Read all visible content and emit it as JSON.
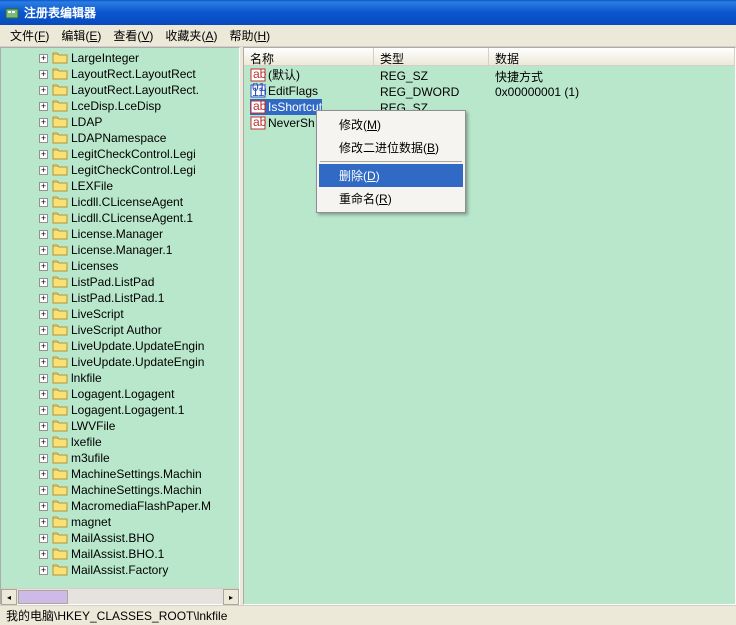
{
  "window": {
    "title": "注册表编辑器"
  },
  "menubar": {
    "file": "文件",
    "file_accel": "F",
    "edit": "编辑",
    "edit_accel": "E",
    "view": "查看",
    "view_accel": "V",
    "fav": "收藏夹",
    "fav_accel": "A",
    "help": "帮助",
    "help_accel": "H"
  },
  "tree": {
    "items": [
      {
        "label": "LargeInteger"
      },
      {
        "label": "LayoutRect.LayoutRect"
      },
      {
        "label": "LayoutRect.LayoutRect."
      },
      {
        "label": "LceDisp.LceDisp"
      },
      {
        "label": "LDAP"
      },
      {
        "label": "LDAPNamespace"
      },
      {
        "label": "LegitCheckControl.Legi"
      },
      {
        "label": "LegitCheckControl.Legi"
      },
      {
        "label": "LEXFile"
      },
      {
        "label": "Licdll.CLicenseAgent"
      },
      {
        "label": "Licdll.CLicenseAgent.1"
      },
      {
        "label": "License.Manager"
      },
      {
        "label": "License.Manager.1"
      },
      {
        "label": "Licenses"
      },
      {
        "label": "ListPad.ListPad"
      },
      {
        "label": "ListPad.ListPad.1"
      },
      {
        "label": "LiveScript"
      },
      {
        "label": "LiveScript Author"
      },
      {
        "label": "LiveUpdate.UpdateEngin"
      },
      {
        "label": "LiveUpdate.UpdateEngin"
      },
      {
        "label": "lnkfile"
      },
      {
        "label": "Logagent.Logagent"
      },
      {
        "label": "Logagent.Logagent.1"
      },
      {
        "label": "LWVFile"
      },
      {
        "label": "lxefile"
      },
      {
        "label": "m3ufile"
      },
      {
        "label": "MachineSettings.Machin"
      },
      {
        "label": "MachineSettings.Machin"
      },
      {
        "label": "MacromediaFlashPaper.M"
      },
      {
        "label": "magnet"
      },
      {
        "label": "MailAssist.BHO"
      },
      {
        "label": "MailAssist.BHO.1"
      },
      {
        "label": "MailAssist.Factory"
      }
    ]
  },
  "list": {
    "columns": {
      "name": "名称",
      "type": "类型",
      "data": "数据"
    },
    "rows": [
      {
        "icon": "string",
        "name": "(默认)",
        "type": "REG_SZ",
        "data": "快捷方式"
      },
      {
        "icon": "binary",
        "name": "EditFlags",
        "type": "REG_DWORD",
        "data": "0x00000001 (1)"
      },
      {
        "icon": "string",
        "name": "IsShortcut",
        "type": "REG_SZ",
        "data": "",
        "selected": true
      },
      {
        "icon": "string",
        "name": "NeverSh",
        "type": "",
        "data": ""
      }
    ]
  },
  "context_menu": {
    "modify": "修改",
    "modify_accel": "M",
    "modify_bin": "修改二进位数据",
    "modify_bin_accel": "B",
    "delete": "删除",
    "delete_accel": "D",
    "rename": "重命名",
    "rename_accel": "R"
  },
  "statusbar": {
    "path": "我的电脑\\HKEY_CLASSES_ROOT\\lnkfile"
  }
}
